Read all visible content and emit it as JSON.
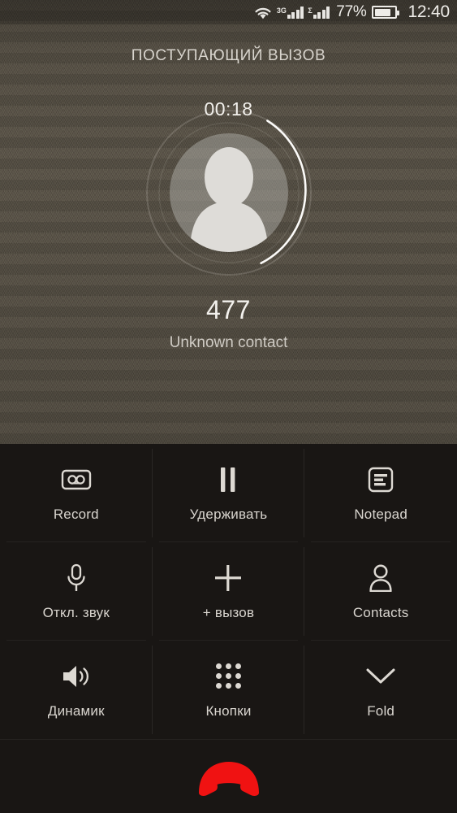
{
  "status_bar": {
    "wifi_icon": "wifi-icon",
    "network_type": "3G",
    "sim1_icon": "signal-bars-icon",
    "sim2_badge": "sim2-icon",
    "sim2_icon": "signal-bars-icon",
    "battery_percent": "77%",
    "battery_icon": "battery-icon",
    "clock": "12:40"
  },
  "call": {
    "state_title": "ПОСТУПАЮЩИЙ ВЫЗОВ",
    "duration": "00:18",
    "number": "477",
    "contact_name": "Unknown contact",
    "avatar_icon": "person-avatar-icon",
    "ring_icon": "call-progress-ring"
  },
  "actions": [
    {
      "label": "Record",
      "icon": "cassette-record-icon"
    },
    {
      "label": "Удерживать",
      "icon": "pause-hold-icon"
    },
    {
      "label": "Notepad",
      "icon": "notepad-icon"
    },
    {
      "label": "Откл. звук",
      "icon": "microphone-mute-icon"
    },
    {
      "label": "+ вызов",
      "icon": "plus-add-call-icon"
    },
    {
      "label": "Contacts",
      "icon": "person-contacts-icon"
    },
    {
      "label": "Динамик",
      "icon": "speaker-icon"
    },
    {
      "label": "Кнопки",
      "icon": "dialpad-icon"
    },
    {
      "label": "Fold",
      "icon": "chevron-down-icon"
    }
  ],
  "end_call": {
    "icon": "end-call-handset-icon",
    "color": "#f01212"
  },
  "colors": {
    "wallpaper": "#575044",
    "panel": "#191614",
    "text_primary": "#f2f0ec",
    "text_secondary": "#cfcbc4",
    "end_call_red": "#f01212",
    "ring_active": "#ffffff"
  }
}
